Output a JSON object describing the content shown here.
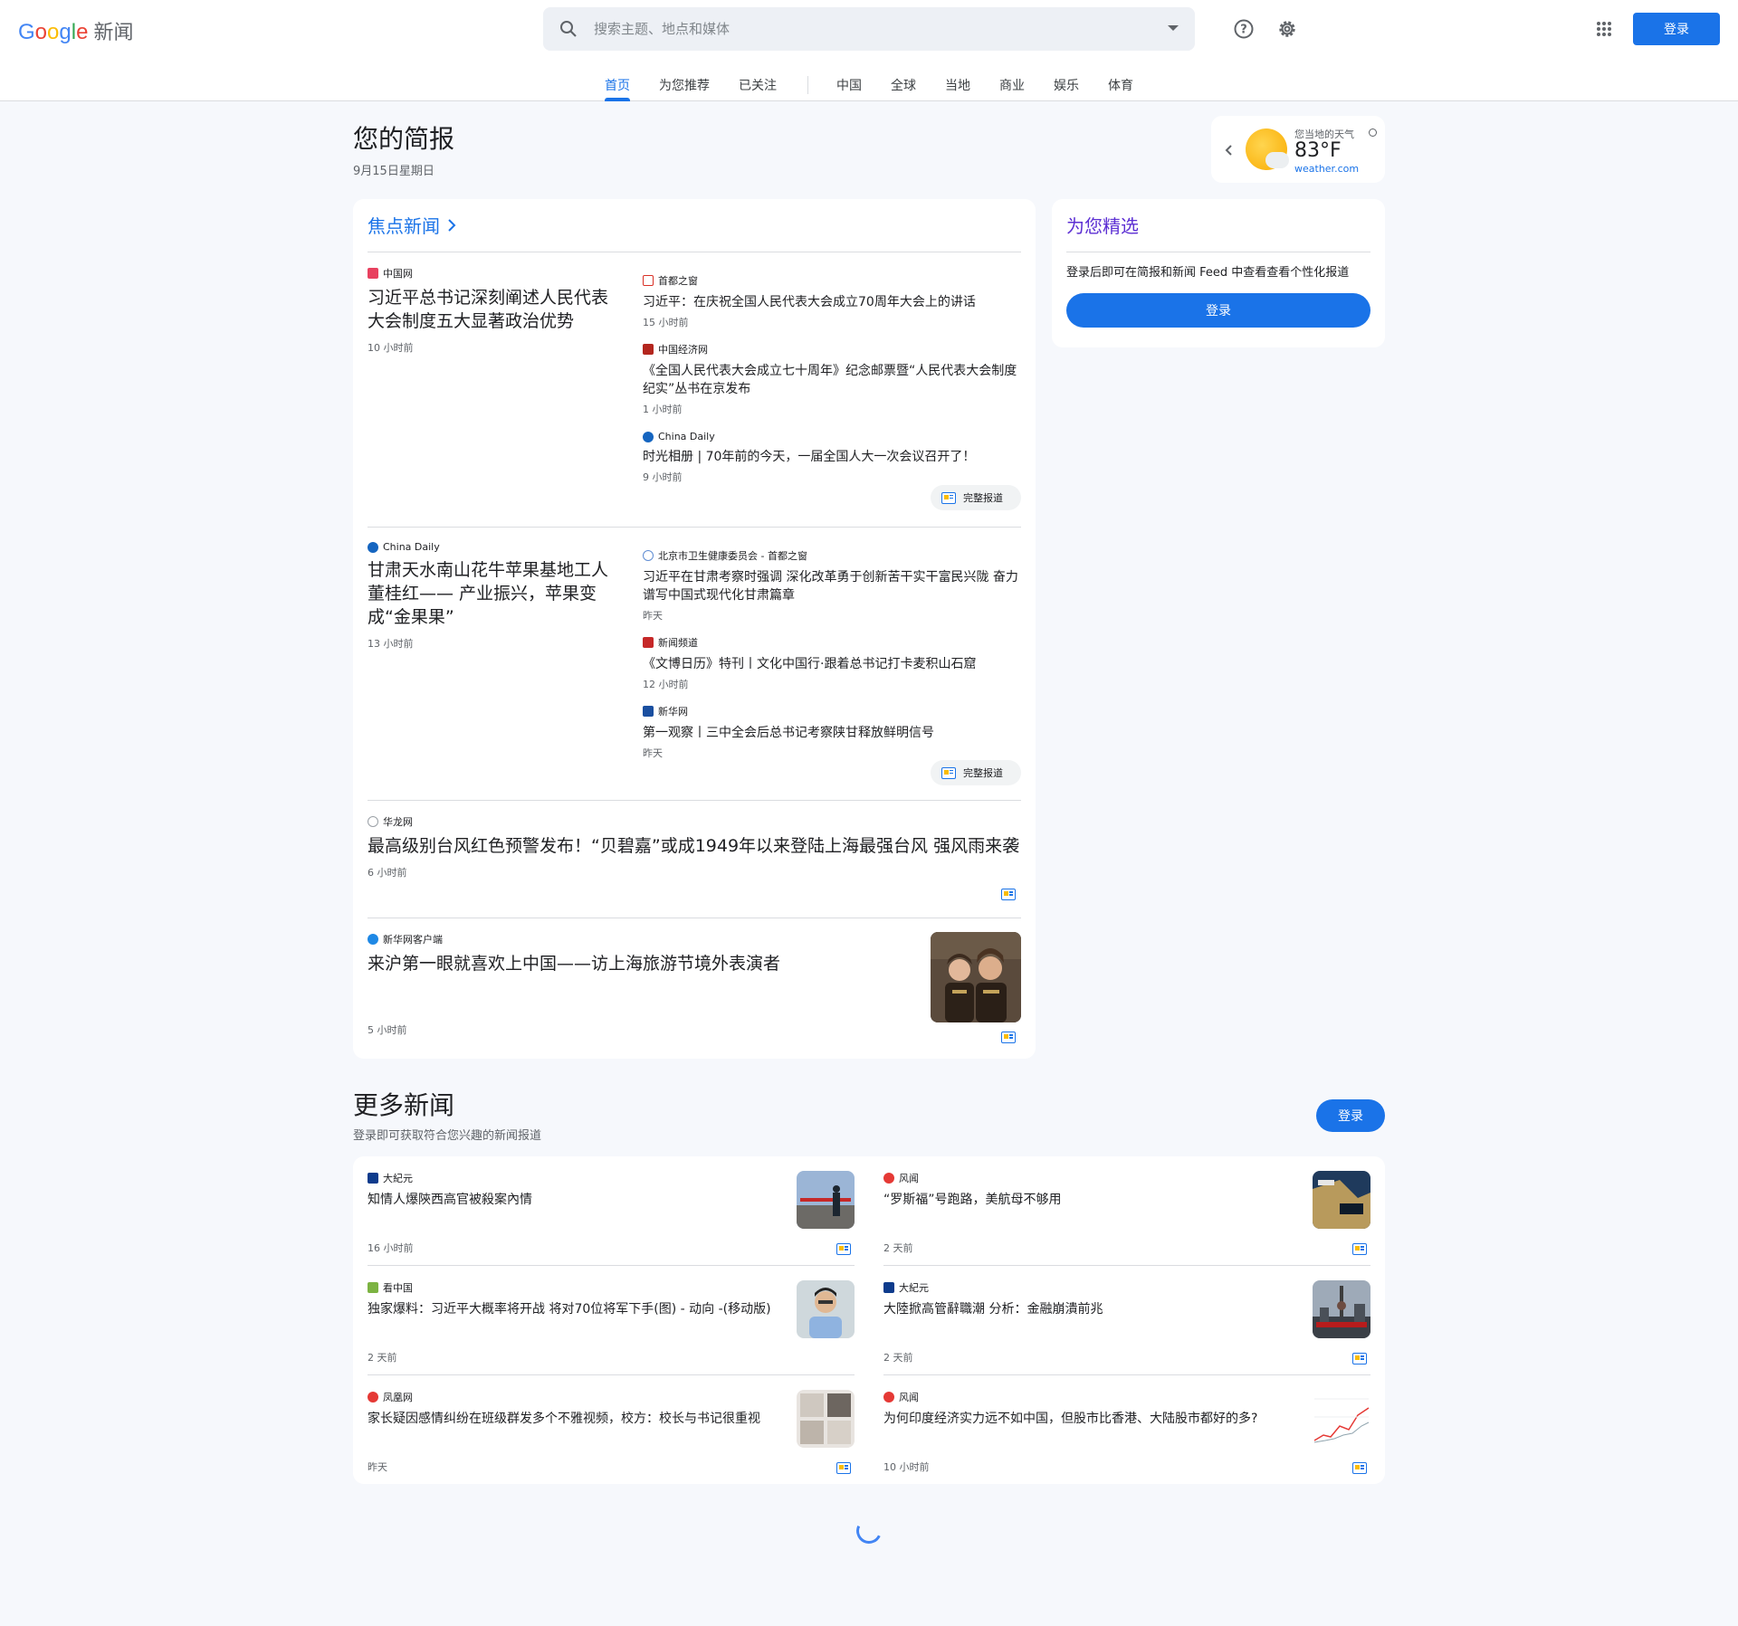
{
  "header": {
    "logo_word": [
      "G",
      "o",
      "o",
      "g",
      "l",
      "e"
    ],
    "product": "新闻",
    "search_placeholder": "搜索主题、地点和媒体",
    "signin": "登录"
  },
  "nav": [
    "首页",
    "为您推荐",
    "已关注",
    "中国",
    "全球",
    "当地",
    "商业",
    "娱乐",
    "体育"
  ],
  "briefing": {
    "title": "您的简报",
    "date": "9月15日星期日"
  },
  "weather": {
    "label": "您当地的天气",
    "temp": "83°F",
    "source": "weather.com"
  },
  "top_stories": {
    "title": "焦点新闻",
    "clusters": [
      {
        "main": {
          "source": "中国网",
          "headline": "习近平总书记深刻阐述人民代表大会制度五大显著政治优势",
          "time": "10 小时前"
        },
        "related": [
          {
            "source": "首都之窗",
            "headline": "习近平：在庆祝全国人民代表大会成立70周年大会上的讲话",
            "time": "15 小时前"
          },
          {
            "source": "中国经济网",
            "headline": "《全国人民代表大会成立七十周年》纪念邮票暨“人民代表大会制度纪实”丛书在京发布",
            "time": "1 小时前"
          },
          {
            "source": "China Daily",
            "headline": "时光相册 | 70年前的今天，一届全国人大一次会议召开了！",
            "time": "9 小时前"
          }
        ],
        "full_coverage": "完整报道"
      },
      {
        "main": {
          "source": "China Daily",
          "headline": "甘肃天水南山花牛苹果基地工人董桂红—— 产业振兴，苹果变成“金果果”",
          "time": "13 小时前"
        },
        "related": [
          {
            "source": "北京市卫生健康委员会 - 首都之窗",
            "headline": "习近平在甘肃考察时强调 深化改革勇于创新苦干实干富民兴陇 奋力谱写中国式现代化甘肃篇章",
            "time": "昨天"
          },
          {
            "source": "新闻频道",
            "headline": "《文博日历》特刊丨文化中国行·跟着总书记打卡麦积山石窟",
            "time": "12 小时前"
          },
          {
            "source": "新华网",
            "headline": "第一观察丨三中全会后总书记考察陕甘释放鲜明信号",
            "time": "昨天"
          }
        ],
        "full_coverage": "完整报道"
      }
    ],
    "singles": [
      {
        "source": "华龙网",
        "headline": "最高级别台风红色预警发布！“贝碧嘉”或成1949年以来登陆上海最强台风 强风雨来袭",
        "time": "6 小时前"
      },
      {
        "source": "新华网客户端",
        "headline": "来沪第一眼就喜欢上中国——访上海旅游节境外表演者",
        "time": "5 小时前"
      }
    ]
  },
  "picks": {
    "title": "为您精选",
    "text": "登录后即可在简报和新闻 Feed 中查看查看个性化报道",
    "button": "登录"
  },
  "more_news": {
    "title": "更多新闻",
    "subtitle": "登录即可获取符合您兴趣的新闻报道",
    "button": "登录",
    "items": [
      {
        "source": "大紀元",
        "headline": "知情人爆陝西高官被殺案內情",
        "time": "16 小时前"
      },
      {
        "source": "风闻",
        "headline": "“罗斯福”号跑路，美航母不够用",
        "time": "2 天前"
      },
      {
        "source": "看中国",
        "headline": "独家爆料：习近平大概率将开战 将对70位将军下手(图) - 动向 -(移动版)",
        "time": "2 天前"
      },
      {
        "source": "大紀元",
        "headline": "大陸掀高管辭職潮 分析：金融崩潰前兆",
        "time": "2 天前"
      },
      {
        "source": "凤凰网",
        "headline": "家长疑因感情纠纷在班级群发多个不雅视频，校方：校长与书记很重视",
        "time": "昨天"
      },
      {
        "source": "风闻",
        "headline": "为何印度经济实力远不如中国，但股市比香港、大陆股市都好的多?",
        "time": "10 小时前"
      }
    ]
  },
  "colors": {
    "accent": "#1a73e8",
    "picks_title": "#5c2fd3",
    "background": "#f6f8fc"
  }
}
